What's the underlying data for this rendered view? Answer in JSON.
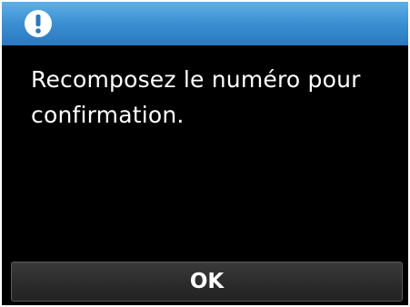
{
  "dialog": {
    "icon": "exclamation-alert-icon",
    "message": "Recomposez le numéro pour\nconfirmation.",
    "ok_label": "OK"
  },
  "colors": {
    "title_bar": "#3a8fd2",
    "background": "#000000",
    "text": "#ffffff",
    "button": "#2a2a2a"
  }
}
